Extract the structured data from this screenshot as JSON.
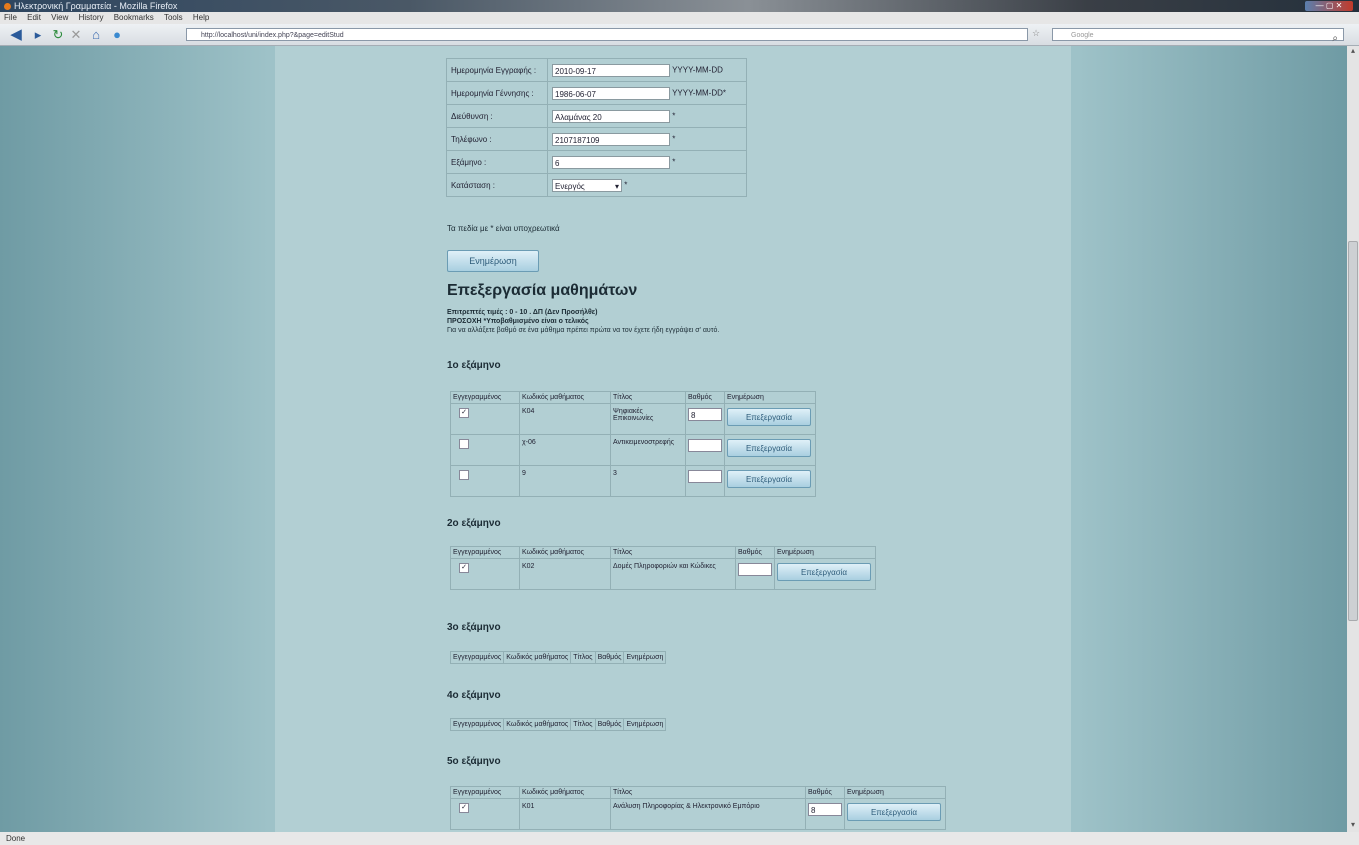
{
  "browser": {
    "window_title": "Ηλεκτρονική Γραμματεία - Mozilla Firefox",
    "menu": [
      "File",
      "Edit",
      "View",
      "History",
      "Bookmarks",
      "Tools",
      "Help"
    ],
    "url": "http://localhost/uni/index.php?&page=editStud",
    "search_placeholder": "Google",
    "status": "Done"
  },
  "form": {
    "rows": [
      {
        "label": "Ημερομηνία Εγγραφής :",
        "value": "2010-09-17",
        "hint": "YYYY-MM-DD"
      },
      {
        "label": "Ημερομηνία Γέννησης :",
        "value": "1986-06-07",
        "hint": "YYYY-MM-DD*"
      },
      {
        "label": "Διεύθυνση :",
        "value": "Αλαμάνας 20",
        "hint": "*"
      },
      {
        "label": "Τηλέφωνο :",
        "value": "2107187109",
        "hint": "*"
      },
      {
        "label": "Εξάμηνο :",
        "value": "6",
        "hint": "*"
      },
      {
        "label": "Κατάσταση :",
        "value": "Ενεργός",
        "hint": "*"
      }
    ],
    "required_note": "Τα πεδία με * είναι υποχρεωτικά",
    "update_button": "Ενημέρωση"
  },
  "courses": {
    "title": "Επεξεργασία μαθημάτων",
    "notes": [
      "Επιτρεπτές τιμές : 0 - 10 . ΔΠ (Δεν Προσήλθε)",
      "ΠΡΟΣΟΧΗ *Υποβαθμισμένο είναι ο τελικός",
      "Για να αλλάξετε βαθμό σε ένα μάθημα πρέπει πρώτα να τον έχετε ήδη εγγράψει σ' αυτό."
    ],
    "headers": [
      "Εγγεγραμμένος",
      "Κωδικός μαθήματος",
      "Τίτλος",
      "Βαθμός",
      "Ενημέρωση"
    ],
    "edit_label": "Επεξεργασία",
    "semesters": [
      {
        "title": "1ο εξάμηνο",
        "rows": [
          {
            "checked": true,
            "code": "K04",
            "name": "Ψηφιακές Επικοινωνίες",
            "grade": "8"
          },
          {
            "checked": false,
            "code": "χ-06",
            "name": "Αντικειμενοστρεφής",
            "grade": ""
          },
          {
            "checked": false,
            "code": "9",
            "name": "3",
            "grade": ""
          }
        ]
      },
      {
        "title": "2ο εξάμηνο",
        "rows": [
          {
            "checked": true,
            "code": "K02",
            "name": "Δομές Πληροφοριών και Κώδικες",
            "grade": ""
          }
        ]
      },
      {
        "title": "3ο εξάμηνο",
        "rows": []
      },
      {
        "title": "4ο εξάμηνο",
        "rows": []
      },
      {
        "title": "5ο εξάμηνο",
        "rows": [
          {
            "checked": true,
            "code": "K01",
            "name": "Ανάλυση Πληροφορίας & Ηλεκτρονικό Εμπόριο",
            "grade": "8"
          }
        ]
      }
    ]
  }
}
